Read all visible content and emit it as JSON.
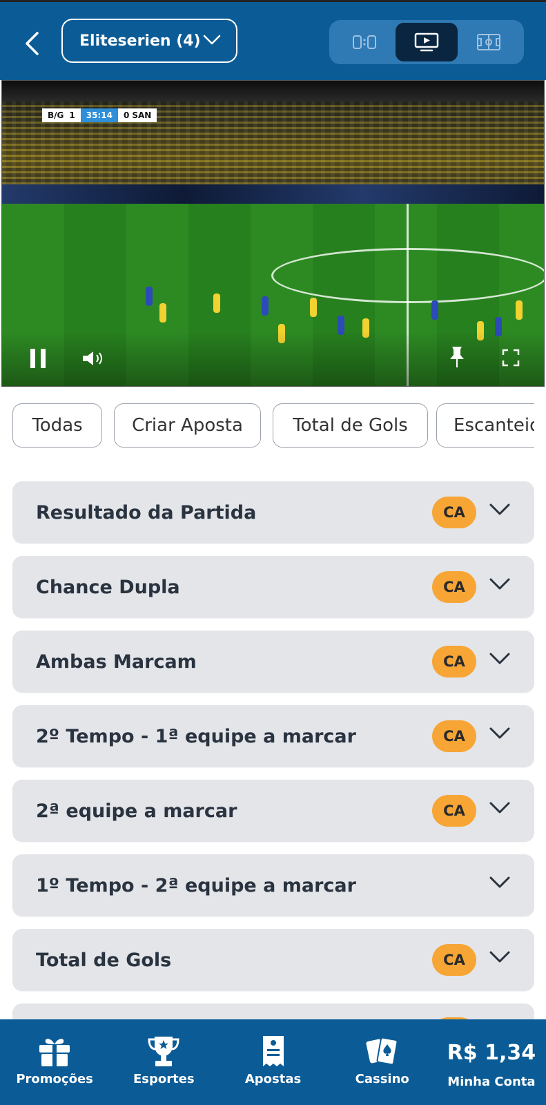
{
  "header": {
    "league_label": "Eliteserien (4)",
    "view_options": [
      "score-icon",
      "tv-icon",
      "field-icon"
    ],
    "active_view": "tv"
  },
  "video": {
    "home_team": "B/G",
    "home_score": "1",
    "clock": "35:14",
    "away_score": "0",
    "away_team": "SAN",
    "state": "playing"
  },
  "filters": [
    "Todas",
    "Criar Aposta",
    "Total de Gols",
    "Escanteio"
  ],
  "markets": [
    {
      "title": "Resultado da Partida",
      "badge": "CA"
    },
    {
      "title": "Chance Dupla",
      "badge": "CA"
    },
    {
      "title": "Ambas Marcam",
      "badge": "CA"
    },
    {
      "title": "2º Tempo - 1ª equipe a marcar",
      "badge": "CA"
    },
    {
      "title": "2ª equipe a marcar",
      "badge": "CA"
    },
    {
      "title": "1º Tempo - 2ª equipe a marcar",
      "badge": ""
    },
    {
      "title": "Total de Gols",
      "badge": "CA"
    }
  ],
  "nav": {
    "promocoes": "Promoções",
    "esportes": "Esportes",
    "apostas": "Apostas",
    "cassino": "Cassino",
    "balance": "R$ 1,34",
    "minha_conta": "Minha Conta"
  },
  "colors": {
    "primary": "#0b5c96",
    "badge": "#f7a535",
    "card": "#e3e5e8"
  }
}
